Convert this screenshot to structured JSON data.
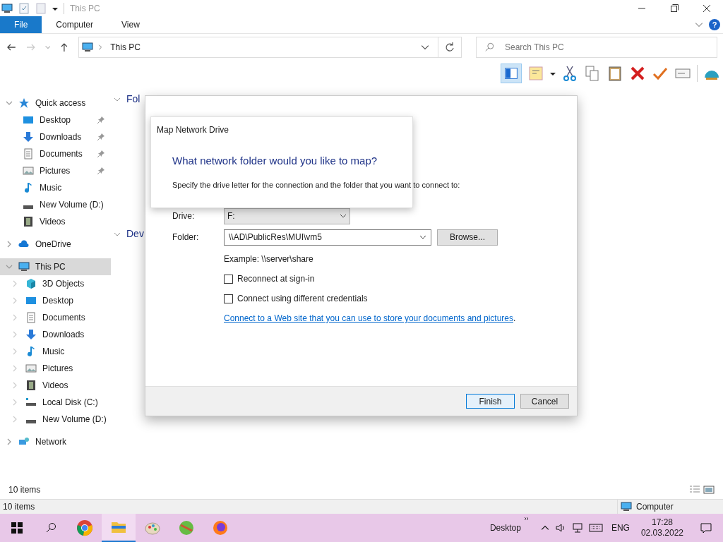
{
  "window": {
    "title": "This PC"
  },
  "ribbon_tabs": [
    {
      "label": "File",
      "selected": true
    },
    {
      "label": "Computer",
      "selected": false
    },
    {
      "label": "View",
      "selected": false
    }
  ],
  "ribbon_help": "?",
  "address": {
    "path": "This PC",
    "search_placeholder": "Search This PC"
  },
  "sidebar": [
    {
      "label": "Quick access",
      "kind": "star",
      "expanded": true,
      "selected": false,
      "children": [
        {
          "label": "Desktop",
          "kind": "desktop",
          "pinned": true
        },
        {
          "label": "Downloads",
          "kind": "download",
          "pinned": true
        },
        {
          "label": "Documents",
          "kind": "document",
          "pinned": true
        },
        {
          "label": "Pictures",
          "kind": "picture",
          "pinned": true
        },
        {
          "label": "Music",
          "kind": "music",
          "pinned": false
        },
        {
          "label": "New Volume (D:)",
          "kind": "drive",
          "pinned": false
        },
        {
          "label": "Videos",
          "kind": "video",
          "pinned": false
        }
      ]
    },
    {
      "label": "OneDrive",
      "kind": "cloud",
      "expanded": false,
      "selected": false
    },
    {
      "label": "This PC",
      "kind": "pc",
      "expanded": true,
      "selected": true,
      "children": [
        {
          "label": "3D Objects",
          "kind": "cube",
          "pinned": false
        },
        {
          "label": "Desktop",
          "kind": "desktop",
          "pinned": false
        },
        {
          "label": "Documents",
          "kind": "document",
          "pinned": false
        },
        {
          "label": "Downloads",
          "kind": "download",
          "pinned": false
        },
        {
          "label": "Music",
          "kind": "music",
          "pinned": false
        },
        {
          "label": "Pictures",
          "kind": "picture",
          "pinned": false
        },
        {
          "label": "Videos",
          "kind": "video",
          "pinned": false
        },
        {
          "label": "Local Disk (C:)",
          "kind": "disk",
          "pinned": false
        },
        {
          "label": "New Volume (D:)",
          "kind": "drive",
          "pinned": false
        }
      ]
    },
    {
      "label": "Network",
      "kind": "network",
      "expanded": false,
      "selected": false
    }
  ],
  "content_groups": [
    "Fol",
    "Dev"
  ],
  "dialog": {
    "title": "Map Network Drive",
    "heading": "What network folder would you like to map?",
    "instruction": "Specify the drive letter for the connection and the folder that you want to connect to:",
    "drive": {
      "label": "Drive:",
      "value": "F:"
    },
    "folder": {
      "label": "Folder:",
      "value": "\\\\AD\\PublicRes\\MUI\\vm5"
    },
    "browse": "Browse...",
    "example": "Example: \\\\server\\share",
    "checkboxes": [
      {
        "label": "Reconnect at sign-in",
        "checked": false
      },
      {
        "label": "Connect using different credentials",
        "checked": false
      }
    ],
    "link": "Connect to a Web site that you can use to store your documents and pictures",
    "link_suffix": ".",
    "buttons": [
      {
        "label": "Finish",
        "default": true
      },
      {
        "label": "Cancel",
        "default": false
      }
    ]
  },
  "status_bar": "10 items",
  "status_bar_2": {
    "items": "10 items",
    "location": "Computer"
  },
  "taskbar": {
    "apps": [
      {
        "kind": "chrome",
        "active": false
      },
      {
        "kind": "explorer",
        "active": true
      },
      {
        "kind": "paint",
        "active": false
      },
      {
        "kind": "map",
        "active": false
      },
      {
        "kind": "firefox",
        "active": false
      }
    ],
    "toolbar": "Desktop",
    "language": "ENG",
    "time": "17:28",
    "date": "02.03.2022"
  }
}
